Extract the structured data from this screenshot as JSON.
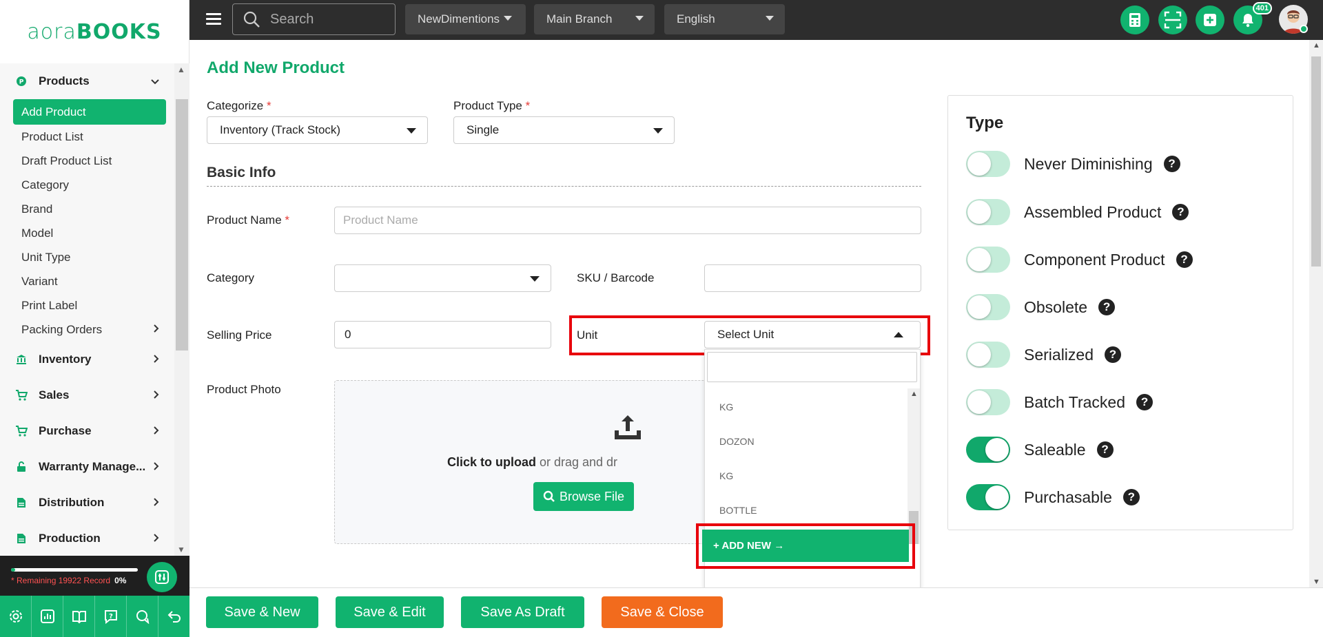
{
  "logo": {
    "part1": "aora",
    "part2": "BOOKS"
  },
  "topbar": {
    "search_placeholder": "Search",
    "company": "NewDimentions",
    "branch": "Main Branch",
    "language": "English",
    "notification_count": "401"
  },
  "sidebar": {
    "products_label": "Products",
    "product_items": [
      {
        "label": "Add Product"
      },
      {
        "label": "Product List"
      },
      {
        "label": "Draft Product List"
      },
      {
        "label": "Category"
      },
      {
        "label": "Brand"
      },
      {
        "label": "Model"
      },
      {
        "label": "Unit Type"
      },
      {
        "label": "Variant"
      },
      {
        "label": "Print Label"
      },
      {
        "label": "Packing Orders"
      }
    ],
    "groups": [
      {
        "label": "Inventory"
      },
      {
        "label": "Sales"
      },
      {
        "label": "Purchase"
      },
      {
        "label": "Warranty Manage..."
      },
      {
        "label": "Distribution"
      },
      {
        "label": "Production"
      }
    ],
    "remaining_text": "* Remaining 19922 Record",
    "remaining_pct": "0%"
  },
  "form": {
    "title": "Add New Product",
    "categorize_label": "Categorize",
    "categorize_value": "Inventory (Track Stock)",
    "product_type_label": "Product Type",
    "product_type_value": "Single",
    "basic_info": "Basic Info",
    "product_name_label": "Product Name",
    "product_name_placeholder": "Product Name",
    "category_label": "Category",
    "sku_label": "SKU / Barcode",
    "selling_price_label": "Selling Price",
    "selling_price_value": "0",
    "unit_label": "Unit",
    "unit_value": "Select Unit",
    "photo_label": "Product Photo",
    "upload_bold": "Click to upload",
    "upload_rest": " or drag and dr",
    "browse_label": "Browse File",
    "required_mark": "*"
  },
  "unit_dropdown": {
    "items": [
      {
        "label": "KG"
      },
      {
        "label": "DOZON"
      },
      {
        "label": "KG"
      },
      {
        "label": "BOTTLE"
      }
    ],
    "add_new": "+ ADD NEW →"
  },
  "type_panel": {
    "title": "Type",
    "toggles": [
      {
        "label": "Never Diminishing",
        "on": false
      },
      {
        "label": "Assembled Product",
        "on": false
      },
      {
        "label": "Component Product",
        "on": false
      },
      {
        "label": "Obsolete",
        "on": false
      },
      {
        "label": "Serialized",
        "on": false
      },
      {
        "label": "Batch Tracked",
        "on": false
      },
      {
        "label": "Saleable",
        "on": true
      },
      {
        "label": "Purchasable",
        "on": true
      }
    ]
  },
  "footer": {
    "save_new": "Save & New",
    "save_edit": "Save & Edit",
    "save_draft": "Save As Draft",
    "save_close": "Save & Close"
  },
  "colors": {
    "brand_green": "#11b36f",
    "dark_bar": "#2d2d2d",
    "highlight_red": "#e8000b",
    "close_orange": "#f26b1d"
  }
}
